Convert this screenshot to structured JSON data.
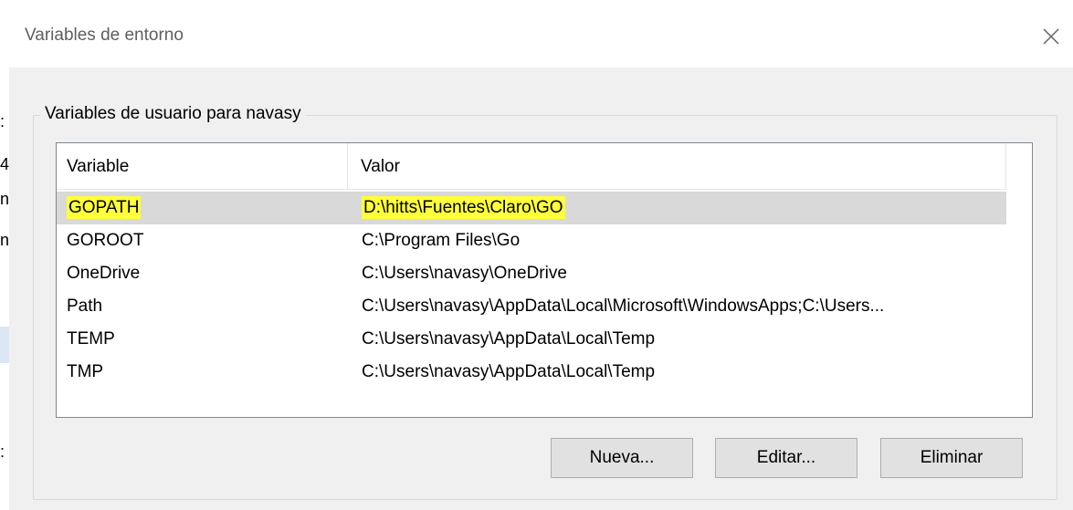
{
  "dialog": {
    "title": "Variables de entorno",
    "close_icon": "close-icon"
  },
  "user_vars": {
    "legend": "Variables de usuario para navasy",
    "columns": [
      "Variable",
      "Valor"
    ],
    "rows": [
      {
        "variable": "GOPATH",
        "value": "D:\\hitts\\Fuentes\\Claro\\GO",
        "selected": true,
        "highlighted": true
      },
      {
        "variable": "GOROOT",
        "value": "C:\\Program Files\\Go"
      },
      {
        "variable": "OneDrive",
        "value": "C:\\Users\\navasy\\OneDrive"
      },
      {
        "variable": "Path",
        "value": "C:\\Users\\navasy\\AppData\\Local\\Microsoft\\WindowsApps;C:\\Users..."
      },
      {
        "variable": "TEMP",
        "value": "C:\\Users\\navasy\\AppData\\Local\\Temp"
      },
      {
        "variable": "TMP",
        "value": "C:\\Users\\navasy\\AppData\\Local\\Temp"
      }
    ],
    "buttons": {
      "new_label": "Nueva...",
      "edit_label": "Editar...",
      "delete_label": "Eliminar"
    }
  },
  "background_fragments": [
    ":",
    "4",
    "n",
    "n",
    ":"
  ],
  "colors": {
    "highlight": "#ffff3a",
    "selected_row": "#d9d9d9",
    "client_bg": "#f0f0f0"
  }
}
